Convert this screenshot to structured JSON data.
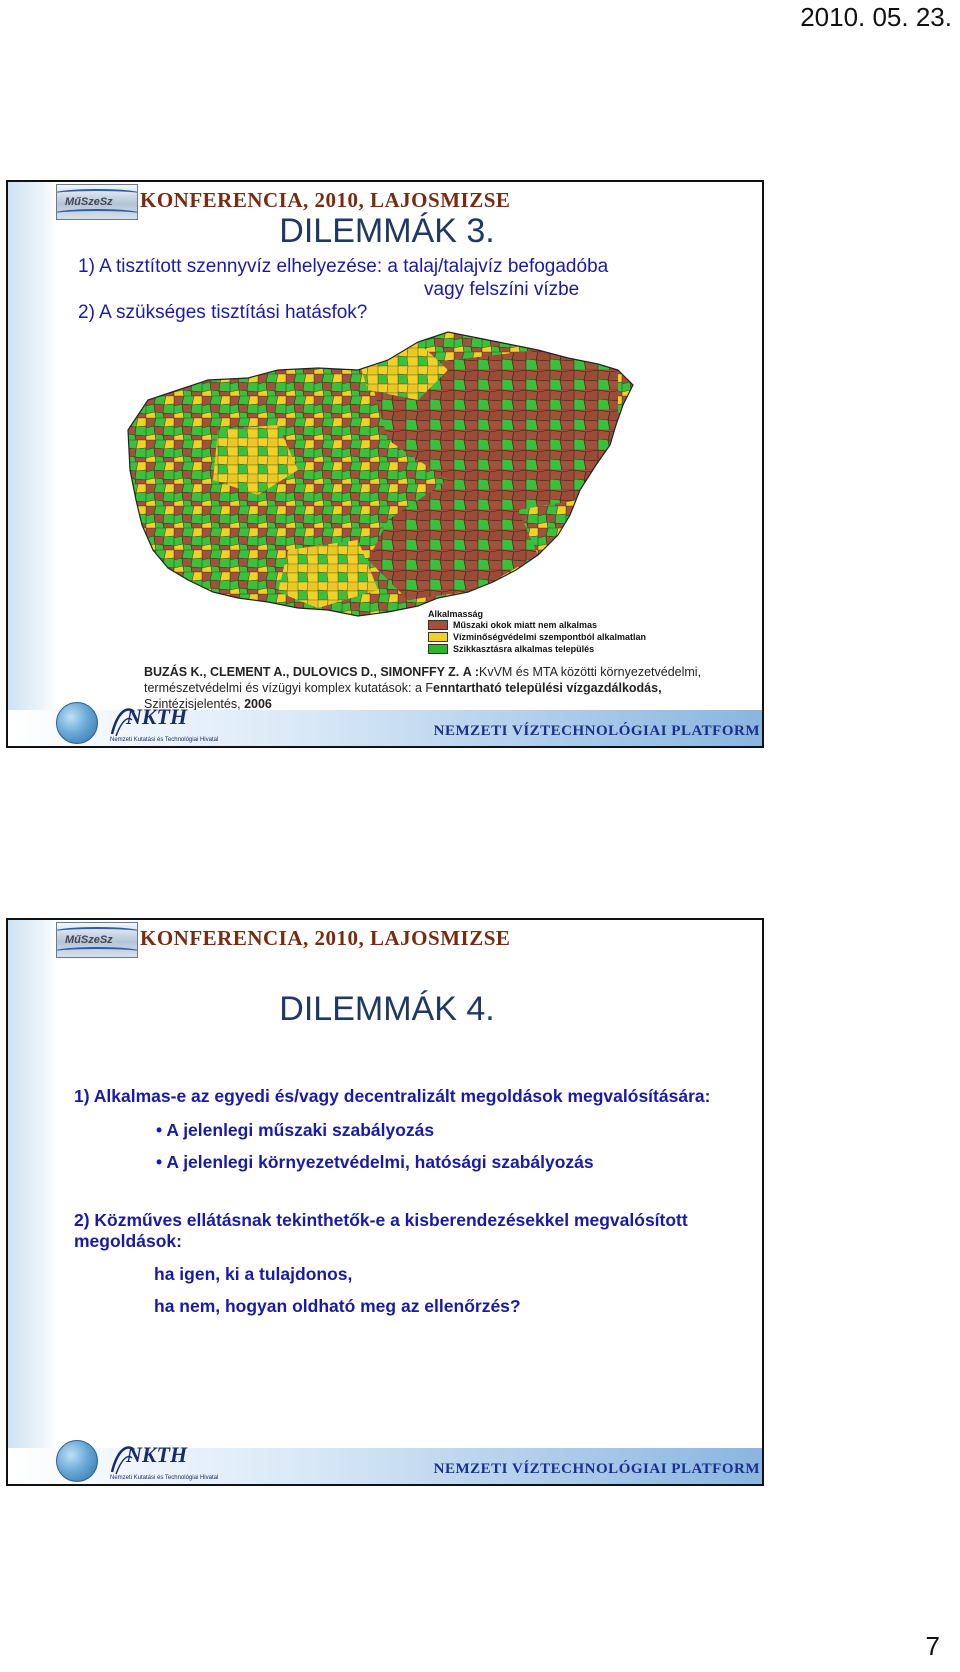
{
  "page": {
    "date": "2010. 05. 23.",
    "number": "7"
  },
  "slide1": {
    "conference": "KONFERENCIA, 2010, LAJOSMIZSE",
    "logo_text": "MűSzeSz",
    "title": "DILEMMÁK 3.",
    "line1": "1) A tisztított szennyvíz elhelyezése: a talaj/talajvíz befogadóba",
    "line1b": "vagy felszíni vízbe",
    "line2": "2) A szükséges tisztítási hatásfok?",
    "legend": {
      "title": "Alkalmasság",
      "items": [
        {
          "label": "Műszaki okok miatt nem alkalmas",
          "color": "#a0523d"
        },
        {
          "label": "Vízminőségvédelmi szempontból alkalmatlan",
          "color": "#f2d02c"
        },
        {
          "label": "Szikkasztásra alkalmas település",
          "color": "#2fb52f"
        }
      ]
    },
    "citation": {
      "authors": "BUZÁS K., CLEMENT A., DULOVICS D., SIMONFFY Z.",
      "prefix": "A :",
      "part1": "KvVM és MTA közötti környezetvédelmi, természetvédelmi és vízügyi komplex kutatások: a F",
      "bold_title": "enntartható települési vízgazdálkodás,",
      "report": "Szintézisjelentés,",
      "year": "2006"
    },
    "footer": "NEMZETI VÍZTECHNOLÓGIAI PLATFORM",
    "nkth": "NKTH",
    "nkth_sub": "Nemzeti Kutatási és Technológiai Hivatal"
  },
  "slide2": {
    "conference": "KONFERENCIA, 2010, LAJOSMIZSE",
    "logo_text": "MűSzeSz",
    "title": "DILEMMÁK 4.",
    "q1": "1) Alkalmas-e az egyedi és/vagy decentralizált megoldások megvalósítására:",
    "bullets": [
      "A jelenlegi műszaki szabályozás",
      "A jelenlegi környezetvédelmi, hatósági szabályozás"
    ],
    "q2": "2) Közműves ellátásnak tekinthetők-e a kisberendezésekkel megvalósított megoldások:",
    "sub1": "ha igen, ki a tulajdonos,",
    "sub2": "ha nem, hogyan oldható meg az ellenőrzés?",
    "footer": "NEMZETI VÍZTECHNOLÓGIAI PLATFORM",
    "nkth": "NKTH",
    "nkth_sub": "Nemzeti Kutatási és Technológiai Hivatal"
  }
}
